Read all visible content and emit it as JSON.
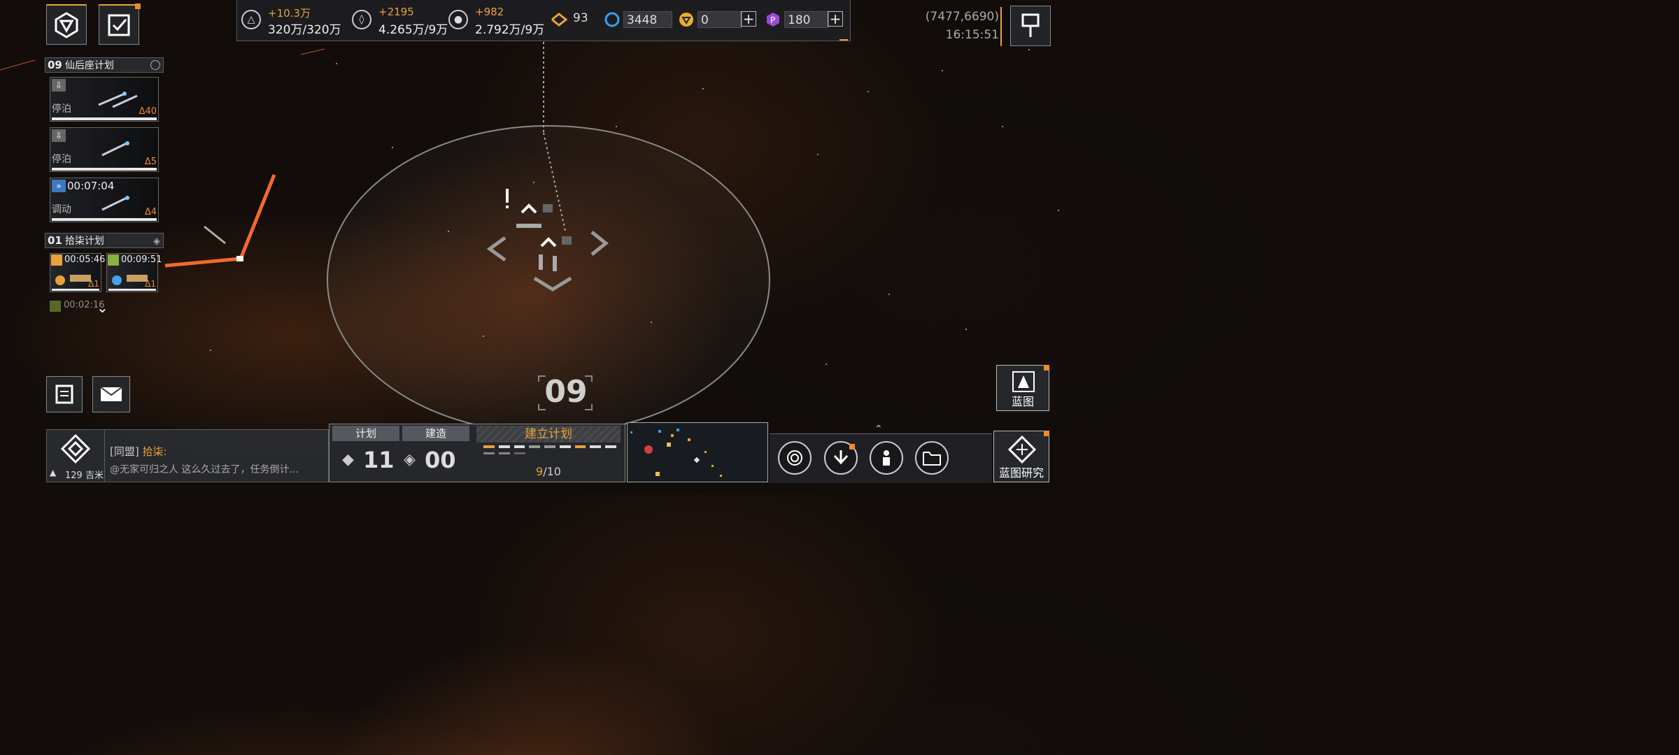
{
  "resources": [
    {
      "icon": "ore-icon",
      "delta": "+10.3万",
      "value": "320万/320万"
    },
    {
      "icon": "crystal-icon",
      "delta": "+2195",
      "value": "4.265万/9万"
    },
    {
      "icon": "gas-icon",
      "delta": "+982",
      "value": "2.792万/9万"
    }
  ],
  "currencies": {
    "rank_value": "93",
    "credits": "3448",
    "gold": "0",
    "premium": "180"
  },
  "coordinates": "(7477,6690)",
  "clock": "16:15:51",
  "fleet_groups": [
    {
      "number": "09",
      "name": "仙后座计划",
      "cards": [
        {
          "state": "停泊",
          "count": "Δ40",
          "timer": ""
        },
        {
          "state": "停泊",
          "count": "Δ5",
          "timer": ""
        },
        {
          "state": "调动",
          "count": "Δ4",
          "timer": "00:07:04"
        }
      ]
    },
    {
      "number": "01",
      "name": "拾柒计划",
      "minis": [
        {
          "time": "00:05:46",
          "count": "Δ1"
        },
        {
          "time": "00:09:51",
          "count": "Δ1"
        }
      ],
      "extra_time": "00:02:16"
    }
  ],
  "map_label": "09",
  "chat": {
    "channel": "[同盟]",
    "sender": "拾柒:",
    "message": "@无家可归之人 这么久过去了，任务倒计...",
    "distance": "129 吉米"
  },
  "plan_panel": {
    "tab_plan": "计划",
    "tab_build": "建造",
    "plan_count": "11",
    "build_count": "00",
    "title": "建立计划",
    "progress_current": "9",
    "progress_total": "/10"
  },
  "blueprint_label": "蓝图",
  "blueprint_research_label": "蓝图研究",
  "colors": {
    "accent": "#e8a23a",
    "orange_line": "#f26a2a",
    "panel": "#2d2f34"
  }
}
